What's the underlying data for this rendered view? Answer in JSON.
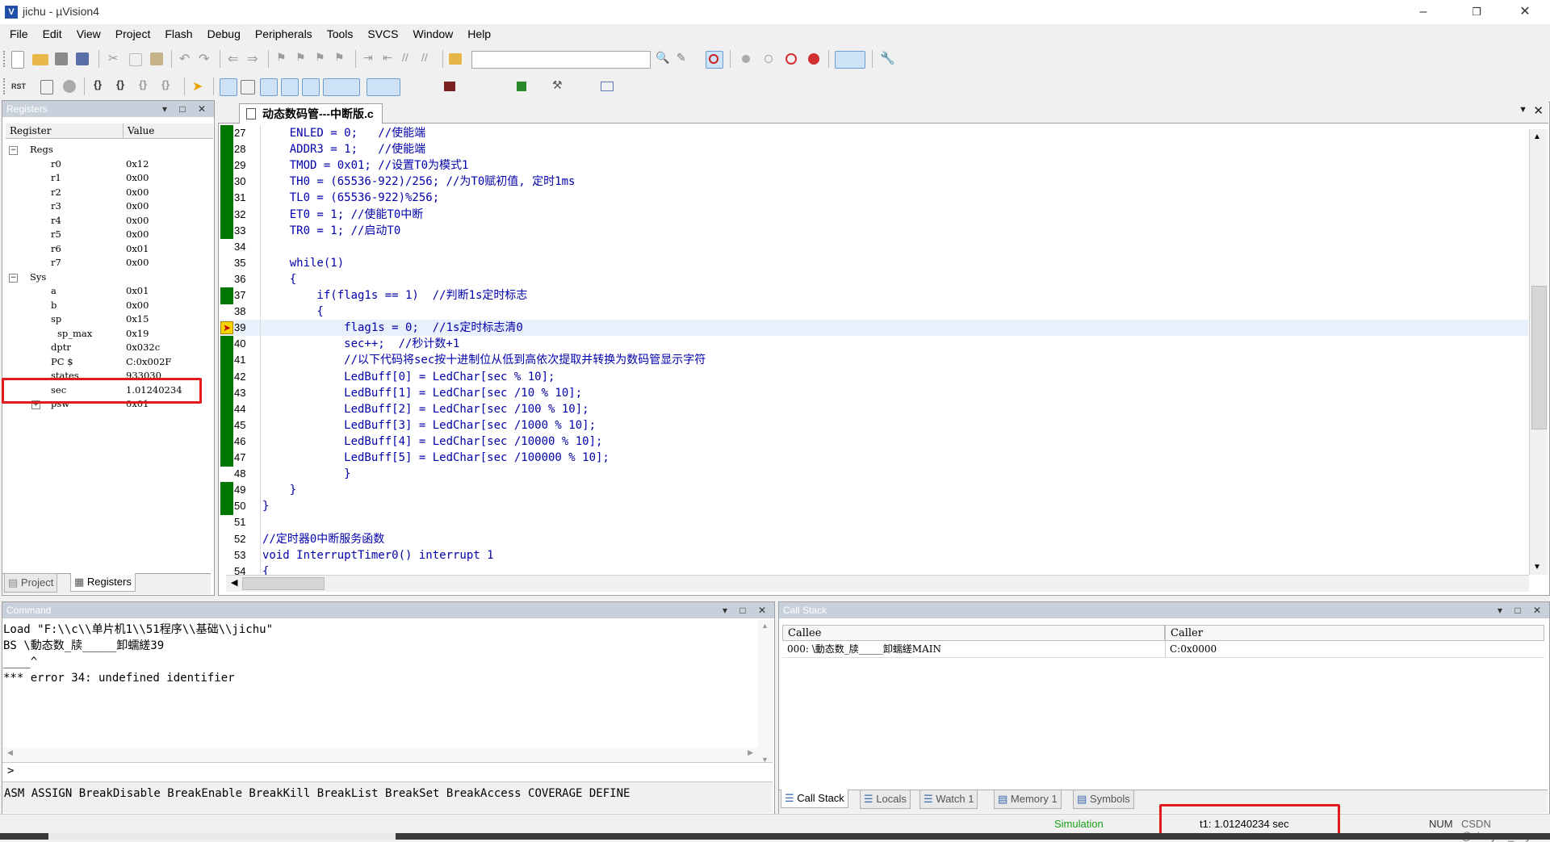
{
  "window": {
    "title": "jichu - µVision4",
    "app_icon": "V"
  },
  "menu": [
    "File",
    "Edit",
    "View",
    "Project",
    "Flash",
    "Debug",
    "Peripherals",
    "Tools",
    "SVCS",
    "Window",
    "Help"
  ],
  "registers": {
    "title": "Registers",
    "col_register": "Register",
    "col_value": "Value",
    "regs_group": "Regs",
    "sys_group": "Sys",
    "rows": [
      {
        "name": "r0",
        "value": "0x12"
      },
      {
        "name": "r1",
        "value": "0x00"
      },
      {
        "name": "r2",
        "value": "0x00"
      },
      {
        "name": "r3",
        "value": "0x00"
      },
      {
        "name": "r4",
        "value": "0x00"
      },
      {
        "name": "r5",
        "value": "0x00"
      },
      {
        "name": "r6",
        "value": "0x01"
      },
      {
        "name": "r7",
        "value": "0x00"
      }
    ],
    "sys_rows": [
      {
        "name": "a",
        "value": "0x01"
      },
      {
        "name": "b",
        "value": "0x00"
      },
      {
        "name": "sp",
        "value": "0x15"
      },
      {
        "name": "sp_max",
        "value": "0x19"
      },
      {
        "name": "dptr",
        "value": "0x032c"
      },
      {
        "name": "PC  $",
        "value": "C:0x002F"
      },
      {
        "name": "states",
        "value": "933030"
      },
      {
        "name": "sec",
        "value": "1.01240234"
      },
      {
        "name": "psw",
        "value": "0x01"
      }
    ],
    "tabs": [
      "Project",
      "Registers"
    ]
  },
  "editor": {
    "file_tab": "动态数码管---中断版.c",
    "lines": [
      {
        "n": "27",
        "text": "    ENLED = 0;   //使能端",
        "green": true
      },
      {
        "n": "28",
        "text": "    ADDR3 = 1;   //使能端",
        "green": true
      },
      {
        "n": "29",
        "text": "    TMOD = 0x01; //设置T0为模式1",
        "green": true
      },
      {
        "n": "30",
        "text": "    TH0 = (65536-922)/256; //为T0赋初值, 定时1ms",
        "green": true
      },
      {
        "n": "31",
        "text": "    TL0 = (65536-922)%256;",
        "green": true
      },
      {
        "n": "32",
        "text": "    ET0 = 1; //使能T0中断",
        "green": true
      },
      {
        "n": "33",
        "text": "    TR0 = 1; //启动T0",
        "green": true
      },
      {
        "n": "34",
        "text": "",
        "green": false
      },
      {
        "n": "35",
        "text": "    while(1)",
        "green": false
      },
      {
        "n": "36",
        "text": "    {",
        "green": false
      },
      {
        "n": "37",
        "text": "        if(flag1s == 1)  //判断1s定时标志",
        "green": true
      },
      {
        "n": "38",
        "text": "        {",
        "green": false
      },
      {
        "n": "39",
        "text": "            flag1s = 0;  //1s定时标志清0",
        "green": true,
        "current": true
      },
      {
        "n": "40",
        "text": "            sec++;  //秒计数+1",
        "green": true
      },
      {
        "n": "41",
        "text": "            //以下代码将sec按十进制位从低到高依次提取并转换为数码管显示字符",
        "green": true
      },
      {
        "n": "42",
        "text": "            LedBuff[0] = LedChar[sec % 10];",
        "green": true
      },
      {
        "n": "43",
        "text": "            LedBuff[1] = LedChar[sec /10 % 10];",
        "green": true
      },
      {
        "n": "44",
        "text": "            LedBuff[2] = LedChar[sec /100 % 10];",
        "green": true
      },
      {
        "n": "45",
        "text": "            LedBuff[3] = LedChar[sec /1000 % 10];",
        "green": true
      },
      {
        "n": "46",
        "text": "            LedBuff[4] = LedChar[sec /10000 % 10];",
        "green": true
      },
      {
        "n": "47",
        "text": "            LedBuff[5] = LedChar[sec /100000 % 10];",
        "green": true
      },
      {
        "n": "48",
        "text": "            }",
        "green": false
      },
      {
        "n": "49",
        "text": "    }",
        "green": true
      },
      {
        "n": "50",
        "text": "}",
        "green": true
      },
      {
        "n": "51",
        "text": "",
        "green": false
      },
      {
        "n": "52",
        "text": "//定时器0中断服务函数",
        "green": false
      },
      {
        "n": "53",
        "text": "void InterruptTimer0() interrupt 1",
        "green": false
      },
      {
        "n": "54",
        "text": "{",
        "green": false
      }
    ]
  },
  "command": {
    "title": "Command",
    "output": [
      "Load \"F:\\\\c\\\\单片机1\\\\51程序\\\\基础\\\\jichu\"",
      "BS \\動态数_牍_____卸蠕縒39",
      "____^",
      "*** error 34: undefined identifier"
    ],
    "prompt": ">",
    "hints": "ASM ASSIGN BreakDisable BreakEnable BreakKill BreakList BreakSet BreakAccess COVERAGE DEFINE"
  },
  "callstack": {
    "title": "Call Stack",
    "col_callee": "Callee",
    "col_caller": "Caller",
    "rows": [
      {
        "callee": "000: \\動态数_牍_____卸蠕縒MAIN",
        "caller": "C:0x0000"
      }
    ],
    "tabs": [
      "Call Stack",
      "Locals",
      "Watch 1",
      "Memory 1",
      "Symbols"
    ]
  },
  "status": {
    "mode": "Simulation",
    "timer": "t1: 1.01240234 sec",
    "num_caps": "NUM",
    "right": "CSDN @xiaoyan_any"
  },
  "colors": {
    "accent_red": "#e31a1a",
    "coverage_green": "#007700",
    "panel_title": "#c8d0dc"
  }
}
